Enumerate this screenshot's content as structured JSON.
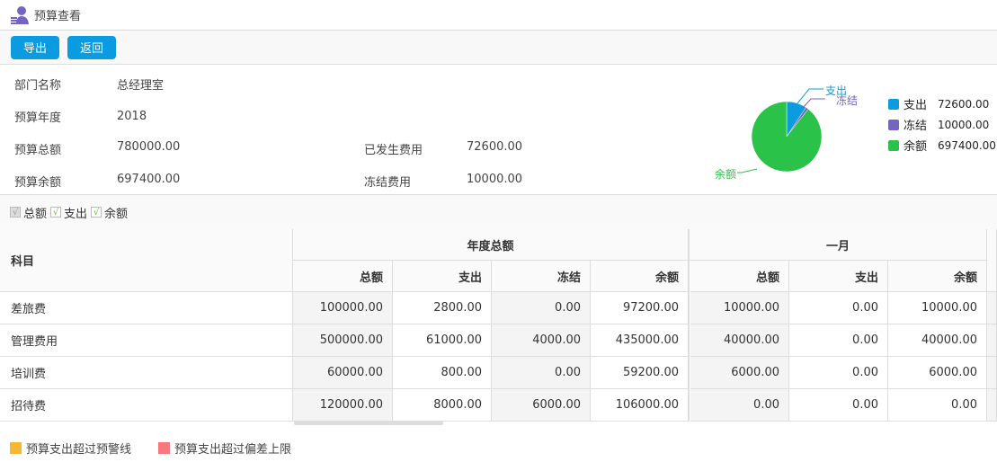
{
  "header": {
    "title": "预算查看",
    "icon": "user-list-icon"
  },
  "toolbar": {
    "export_label": "导出",
    "back_label": "返回"
  },
  "info": {
    "dept_label": "部门名称",
    "dept_value": "总经理室",
    "year_label": "预算年度",
    "year_value": "2018",
    "total_label": "预算总额",
    "total_value": "780000.00",
    "balance_label": "预算余额",
    "balance_value": "697400.00",
    "spent_label": "已发生费用",
    "spent_value": "72600.00",
    "frozen_label": "冻结费用",
    "frozen_value": "10000.00"
  },
  "chart_data": {
    "type": "pie",
    "slices": [
      {
        "name": "支出",
        "value": 72600.0,
        "display": "72600.00",
        "color": "#0b9be0"
      },
      {
        "name": "冻结",
        "value": 10000.0,
        "display": "10000.00",
        "color": "#7565c0"
      },
      {
        "name": "余额",
        "value": 697400.0,
        "display": "697400.00",
        "color": "#2bc24a"
      }
    ],
    "legend": "right"
  },
  "filters": [
    {
      "label": "总额",
      "checked": true,
      "disabled": true
    },
    {
      "label": "支出",
      "checked": true,
      "disabled": false
    },
    {
      "label": "余额",
      "checked": true,
      "disabled": false
    }
  ],
  "table": {
    "subject_header": "科目",
    "groups": [
      "年度总额",
      "一月"
    ],
    "columns": [
      "总额",
      "支出",
      "冻结",
      "余额",
      "总额",
      "支出",
      "余额"
    ],
    "rows": [
      {
        "name": "差旅费",
        "values": [
          "100000.00",
          "2800.00",
          "0.00",
          "97200.00",
          "10000.00",
          "0.00",
          "10000.00"
        ]
      },
      {
        "name": "管理费用",
        "values": [
          "500000.00",
          "61000.00",
          "4000.00",
          "435000.00",
          "40000.00",
          "0.00",
          "40000.00"
        ]
      },
      {
        "name": "培训费",
        "values": [
          "60000.00",
          "800.00",
          "0.00",
          "59200.00",
          "6000.00",
          "0.00",
          "6000.00"
        ]
      },
      {
        "name": "招待费",
        "values": [
          "120000.00",
          "8000.00",
          "6000.00",
          "106000.00",
          "0.00",
          "0.00",
          "0.00"
        ]
      }
    ]
  },
  "legend": [
    {
      "label": "预算支出超过预警线",
      "color": "#f7b733"
    },
    {
      "label": "预算支出超过偏差上限",
      "color": "#f7797d"
    }
  ]
}
